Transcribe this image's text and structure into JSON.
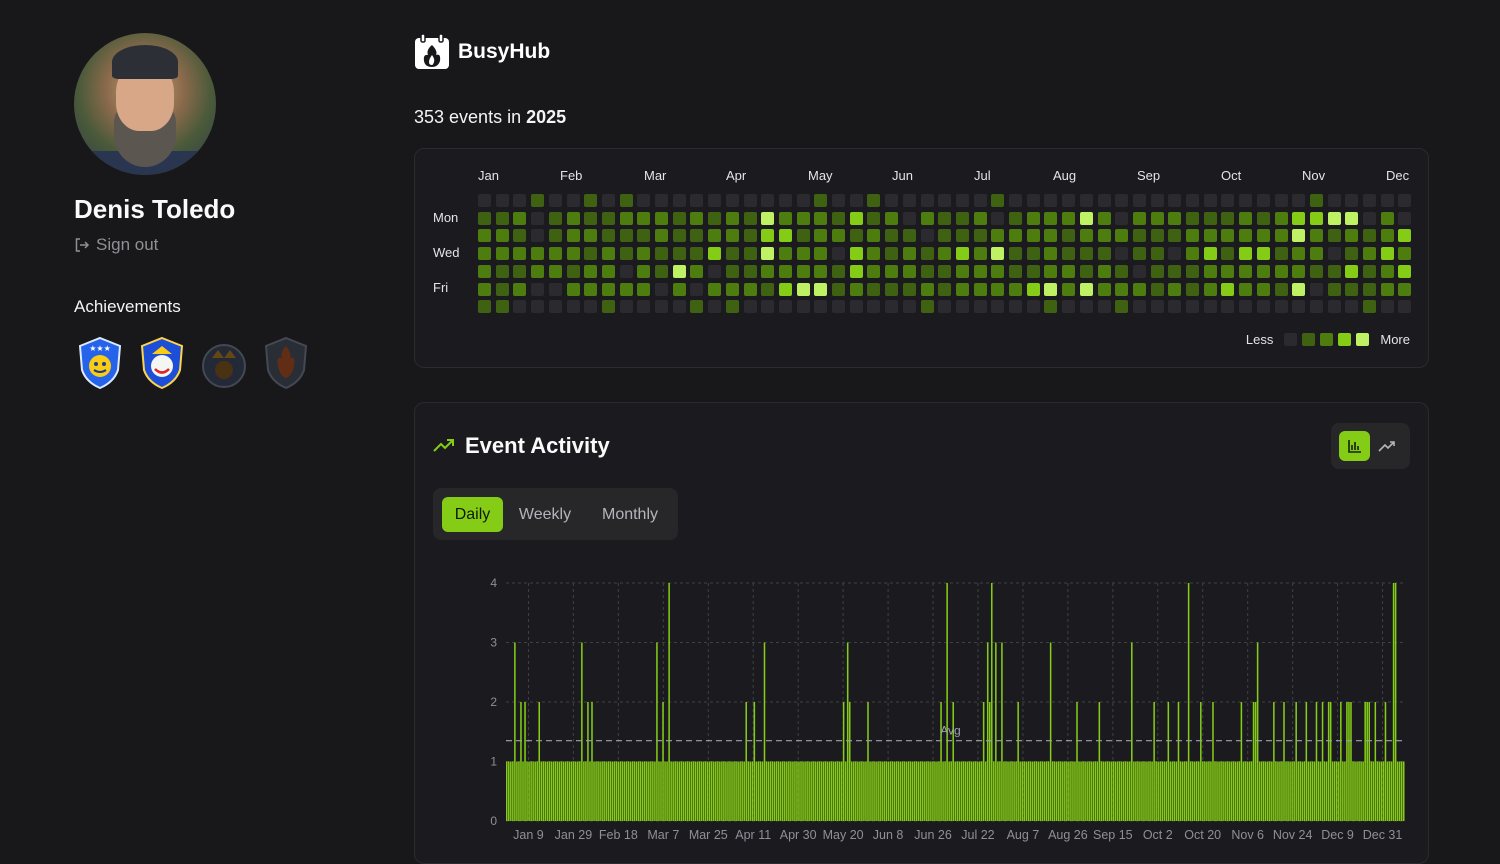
{
  "user": {
    "name": "Denis Toledo",
    "signout_label": "Sign out"
  },
  "achievements": {
    "title": "Achievements",
    "badges": [
      {
        "name": "star-shield-badge",
        "unlocked": true
      },
      {
        "name": "joker-shield-badge",
        "unlocked": true
      },
      {
        "name": "crown-badge",
        "unlocked": false
      },
      {
        "name": "flame-badge",
        "unlocked": false
      }
    ]
  },
  "brand": {
    "name": "BusyHub",
    "icon": "flame-logo-icon"
  },
  "summary": {
    "prefix": "353 events in",
    "year": "2025"
  },
  "heatmap": {
    "months": [
      "Jan",
      "Feb",
      "Mar",
      "Apr",
      "May",
      "Jun",
      "Jul",
      "Aug",
      "Sep",
      "Oct",
      "Nov",
      "Dec"
    ],
    "days": [
      "Mon",
      "Wed",
      "Fri"
    ],
    "legend_less": "Less",
    "legend_more": "More",
    "colors": [
      "#2a2a2f",
      "#3f6212",
      "#4d7c0f",
      "#84cc16",
      "#bef264"
    ]
  },
  "activity": {
    "title": "Event Activity",
    "tabs": [
      "Daily",
      "Weekly",
      "Monthly"
    ],
    "active_tab": "Daily",
    "view_toggle": [
      "bar-chart-icon",
      "trend-line-icon"
    ],
    "accent": "#84cc16"
  },
  "chart_data": {
    "type": "bar",
    "title": "",
    "xlabel": "",
    "ylabel": "",
    "ylim": [
      0,
      4
    ],
    "yticks": [
      0,
      1,
      2,
      3,
      4
    ],
    "x_tick_labels": [
      "Jan 9",
      "Jan 29",
      "Feb 18",
      "Mar 7",
      "Mar 25",
      "Apr 11",
      "Apr 30",
      "May 20",
      "Jun 8",
      "Jun 26",
      "Jul 22",
      "Aug 7",
      "Aug 26",
      "Sep 15",
      "Oct 2",
      "Oct 20",
      "Nov 6",
      "Nov 24",
      "Dec 9",
      "Dec 31"
    ],
    "average_label": "Avg",
    "average": 1.35,
    "grid": true,
    "series": [
      {
        "values": [
          1,
          1,
          1,
          1,
          3,
          1,
          1,
          2,
          1,
          2,
          1,
          1,
          1,
          1,
          1,
          1,
          2,
          1,
          1,
          1,
          1,
          1,
          1,
          1,
          1,
          1,
          1,
          1,
          1,
          1,
          1,
          1,
          1,
          1,
          1,
          1,
          1,
          3,
          1,
          1,
          2,
          1,
          2,
          1,
          1,
          1,
          1,
          1,
          1,
          1,
          1,
          1,
          1,
          1,
          1,
          1,
          1,
          1,
          1,
          1,
          1,
          1,
          1,
          1,
          1,
          1,
          1,
          1,
          1,
          1,
          1,
          1,
          1,
          1,
          3,
          1,
          1,
          2,
          1,
          1,
          4,
          1,
          1,
          1,
          1,
          1,
          1,
          1,
          1,
          1,
          1,
          1,
          1,
          1,
          1,
          1,
          1,
          1,
          1,
          1,
          1,
          1,
          1,
          1,
          1,
          1,
          1,
          1,
          1,
          1,
          1,
          1,
          1,
          1,
          1,
          1,
          1,
          1,
          2,
          1,
          1,
          1,
          2,
          1,
          1,
          1,
          1,
          3,
          1,
          1,
          1,
          1,
          1,
          1,
          1,
          1,
          1,
          1,
          1,
          1,
          1,
          1,
          1,
          1,
          1,
          1,
          1,
          1,
          1,
          1,
          1,
          1,
          1,
          1,
          1,
          1,
          1,
          1,
          1,
          1,
          1,
          1,
          1,
          1,
          1,
          1,
          2,
          1,
          3,
          2,
          1,
          1,
          1,
          1,
          1,
          1,
          1,
          1,
          2,
          1,
          1,
          1,
          1,
          1,
          1,
          1,
          1,
          1,
          1,
          1,
          1,
          1,
          1,
          1,
          1,
          1,
          1,
          1,
          1,
          1,
          1,
          1,
          1,
          1,
          1,
          1,
          1,
          1,
          1,
          1,
          1,
          1,
          1,
          1,
          2,
          1,
          1,
          4,
          1,
          1,
          2,
          1,
          1,
          1,
          1,
          1,
          1,
          1,
          1,
          1,
          1,
          1,
          1,
          1,
          1,
          2,
          1,
          3,
          2,
          4,
          1,
          3,
          1,
          1,
          3,
          1,
          1,
          1,
          1,
          1,
          1,
          1,
          2,
          1,
          1,
          1,
          1,
          1,
          1,
          1,
          1,
          1,
          1,
          1,
          1,
          1,
          1,
          1,
          3,
          1,
          1,
          1,
          1,
          1,
          1,
          1,
          1,
          1,
          1,
          1,
          1,
          2,
          1,
          1,
          1,
          1,
          1,
          1,
          1,
          1,
          1,
          1,
          2,
          1,
          1,
          1,
          1,
          1,
          1,
          1,
          1,
          1,
          1,
          1,
          1,
          1,
          1,
          1,
          3,
          1,
          1,
          1,
          1,
          1,
          1,
          1,
          1,
          1,
          1,
          2,
          1,
          1,
          1,
          1,
          1,
          1,
          2,
          1,
          1,
          1,
          1,
          2,
          1,
          1,
          1,
          1,
          4,
          1,
          1,
          1,
          1,
          1,
          2,
          1,
          1,
          1,
          1,
          1,
          2,
          1,
          1,
          1,
          1,
          1,
          1,
          1,
          1,
          1,
          1,
          1,
          1,
          1,
          2,
          1,
          1,
          1,
          1,
          1,
          2,
          2,
          3,
          1,
          1,
          1,
          1,
          1,
          1,
          1,
          2,
          1,
          1,
          1,
          1,
          2,
          1,
          1,
          1,
          1,
          1,
          2,
          1,
          1,
          1,
          1,
          2,
          1,
          1,
          1,
          1,
          2,
          1,
          1,
          2,
          1,
          1,
          2,
          2,
          1,
          1,
          1,
          1,
          2,
          1,
          1,
          2,
          2,
          2,
          1,
          1,
          1,
          1,
          1,
          1,
          2,
          2,
          2,
          1,
          1,
          2,
          1,
          1,
          1,
          1,
          2,
          1,
          1,
          1,
          4,
          4,
          1,
          1,
          1,
          1
        ]
      }
    ]
  }
}
